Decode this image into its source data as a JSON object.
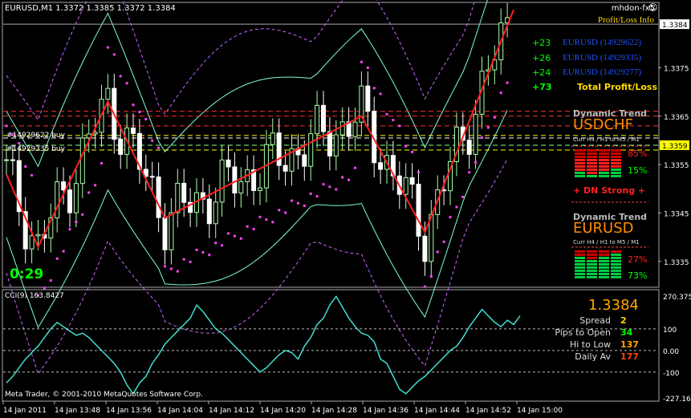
{
  "main": {
    "header": "EURUSD,M1  1.3372 1.3385 1.3372 1.3384",
    "broker": "mhdon-fx5",
    "pl_title": "Profit/Loss Info",
    "trades": [
      {
        "pips": "+23",
        "label": "EURUSD (14929622)"
      },
      {
        "pips": "+26",
        "label": "EURUSD (14929335)"
      },
      {
        "pips": "+24",
        "label": "EURUSD (14929277)"
      }
    ],
    "total": {
      "pips": "+73",
      "label": "Total Profit/Loss"
    },
    "order_labels": [
      "#14929622 buy",
      "#14929335 buy"
    ],
    "timer": "0:29",
    "price_ticks": [
      "1.3384",
      "1.3375",
      "1.3365",
      "1.3359",
      "1.3355",
      "1.3345",
      "1.3335"
    ],
    "price_range": [
      1.333,
      1.3388
    ],
    "current_price": 1.3384,
    "bid_line": 1.3359
  },
  "trend_usdchf": {
    "title": "Dynamic Trend",
    "symbol": "USDCHF",
    "tf": "Curr  H4 / H1  to   M5 / M1",
    "up_pct": "85%",
    "down_pct": "15%",
    "signal": "+ DN Strong +"
  },
  "trend_eurusd": {
    "title": "Dynamic Trend",
    "symbol": "EURUSD",
    "tf": "Curr  H4 / H1  to   M5 / M1",
    "red_pct": "27%",
    "green_pct": "73%"
  },
  "cci": {
    "title": "CCI(9) 163.8427",
    "ticks": [
      "270.3756",
      "100",
      "0.00",
      "-100",
      "-227.1618"
    ],
    "range": [
      -227.1618,
      270.3756
    ],
    "values": [
      -150,
      -120,
      -80,
      -40,
      -10,
      20,
      60,
      100,
      130,
      110,
      90,
      70,
      80,
      60,
      30,
      0,
      -30,
      -60,
      -100,
      -160,
      -200,
      -150,
      -120,
      -60,
      -20,
      30,
      60,
      90,
      120,
      150,
      210,
      180,
      140,
      100,
      80,
      50,
      20,
      -10,
      -40,
      -70,
      -100,
      -80,
      -50,
      -20,
      0,
      -10,
      -40,
      20,
      60,
      120,
      150,
      210,
      250,
      200,
      150,
      110,
      80,
      70,
      40,
      -40,
      -60,
      -120,
      -180,
      -200,
      -170,
      -140,
      -120,
      -90,
      -60,
      -30,
      0,
      20,
      60,
      110,
      150,
      190,
      160,
      130,
      110,
      140,
      120,
      160
    ]
  },
  "stats": {
    "price": "1.3384",
    "rows": [
      {
        "label": "Spread",
        "value": "2",
        "color": "#ffd700"
      },
      {
        "label": "Pips to Open",
        "value": "34",
        "color": "#00ff00"
      },
      {
        "label": "Hi to Low",
        "value": "137",
        "color": "#ffa500"
      },
      {
        "label": "Daily Av",
        "value": "177",
        "color": "#ff4500"
      }
    ]
  },
  "footer": "Meta Trader, © 2001-2010 MetaQuotes Software Corp.",
  "time_axis": [
    "14 Jan 2011",
    "14 Jan 13:48",
    "14 Jan 13:56",
    "14 Jan 14:04",
    "14 Jan 14:12",
    "14 Jan 14:20",
    "14 Jan 14:28",
    "14 Jan 14:36",
    "14 Jan 14:44",
    "14 Jan 14:52",
    "14 Jan 15:00"
  ],
  "colors": {
    "up": "#aaffaa",
    "down": "#ffffff",
    "zigzag": "#ff2020",
    "sar": "#ff44ff",
    "bands": "#7fffd4",
    "envelope": "#cc66ff",
    "cci": "#40e0d0"
  }
}
